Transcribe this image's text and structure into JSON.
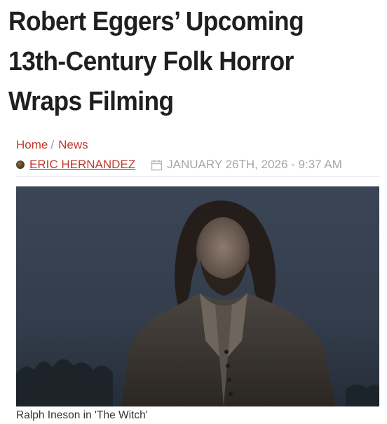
{
  "article": {
    "title": "Robert Eggers’ Upcoming 13th-Century Folk Horror Wraps Filming",
    "breadcrumb": {
      "home": "Home",
      "separator": "/",
      "section": "News"
    },
    "author": "ERIC HERNANDEZ",
    "date": "JANUARY 26TH, 2026 - 9:37 AM",
    "image": {
      "alt": "Ralph Ineson in 'The Witch'",
      "caption": "Ralph Ineson in 'The Witch'"
    }
  },
  "colors": {
    "accent": "#c0392b",
    "muted": "#a6a6a6",
    "title": "#1f1f1f"
  },
  "icons": {
    "author": "author-avatar-icon",
    "date": "calendar-icon"
  }
}
